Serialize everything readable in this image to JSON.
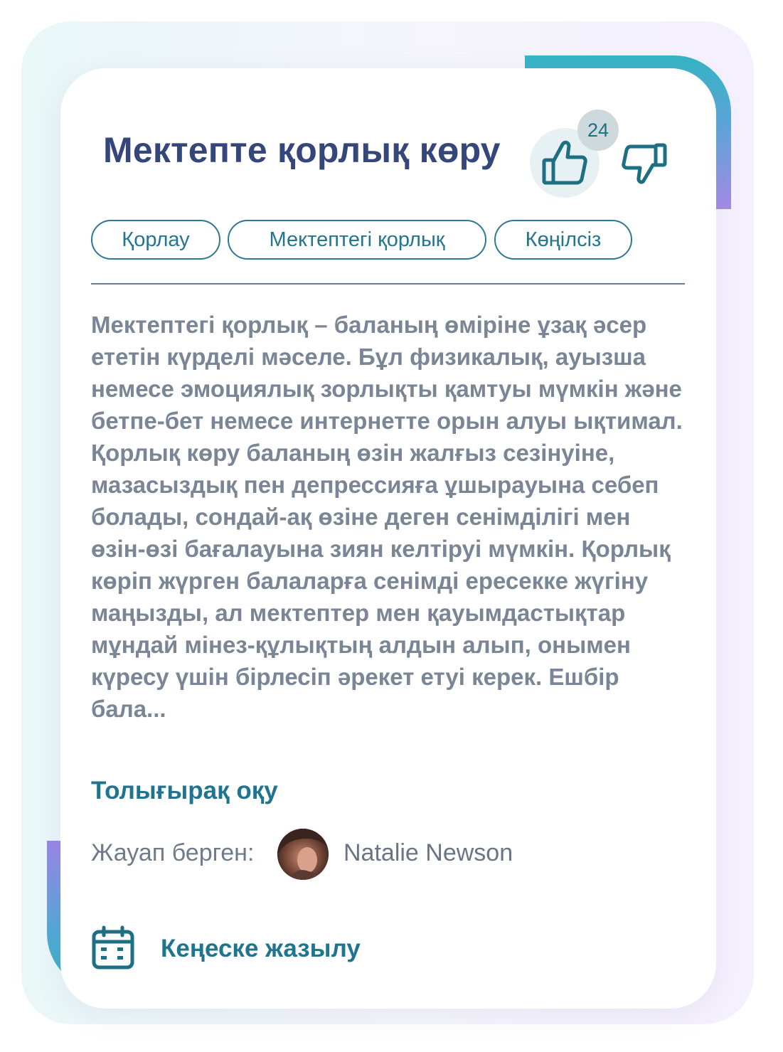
{
  "card": {
    "title": "Мектепте қорлық көру",
    "likes_count": "24",
    "tags": [
      "Қорлау",
      "Мектептегі қорлық",
      "Көңілсіз"
    ],
    "body": "Мектептегі қорлық – баланың өміріне ұзақ әсер ететін күрделі мәселе. Бұл физикалық, ауызша немесе эмоциялық зорлықты қамтуы мүмкін және бетпе-бет немесе интернетте орын алуы ықтимал. Қорлық көру баланың өзін жалғыз сезінуіне, мазасыздық пен депрессияға ұшырауына себеп болады, сондай-ақ өзіне деген сенімділігі мен өзін-өзі бағалауына зиян келтіруі мүмкін. Қорлық көріп жүрген балаларға сенімді ересекке жүгіну маңызды, ал мектептер мен қауымдастықтар мұндай мінез-құлықтың алдын алып, онымен күресу үшін бірлесіп әрекет етуі керек. Ешбір бала...",
    "read_more": "Толығырақ оқу",
    "answered_by_label": "Жауап берген:",
    "author_name": "Natalie Newson",
    "consult_label": "Кеңеске жазылу"
  },
  "icons": {
    "like": "thumbs-up-icon",
    "dislike": "thumbs-down-icon",
    "calendar": "calendar-icon"
  },
  "colors": {
    "title": "#34467a",
    "accent": "#1f7590",
    "tag_border": "#2b7a92",
    "body_text": "#7a8595"
  }
}
